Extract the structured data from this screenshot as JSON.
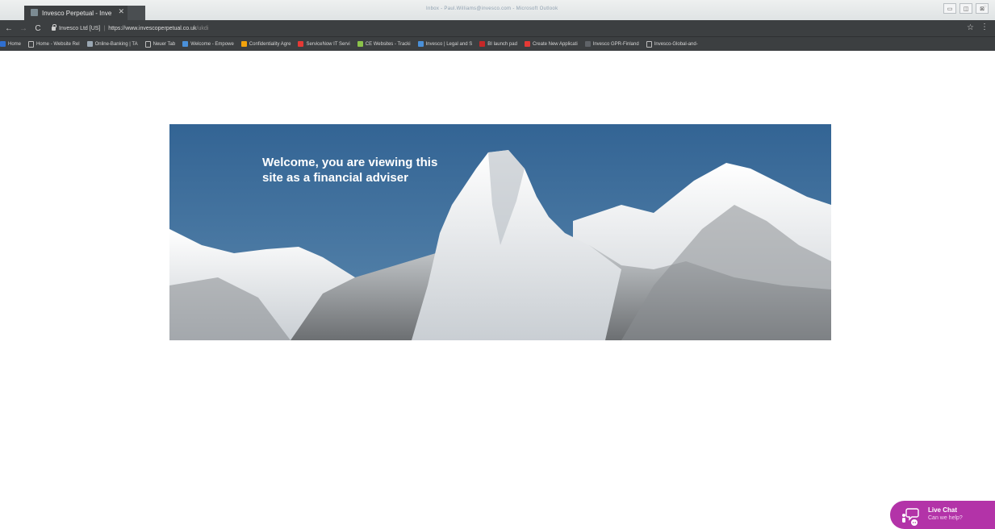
{
  "browser": {
    "tab_title": "Invesco Perpetual - Inve",
    "tab_close": "✕",
    "window_title": "Inbox - Paul.Williams@invesco.com - Microsoft Outlook",
    "controls": [
      "▭",
      "◫",
      "⊠"
    ]
  },
  "address_bar": {
    "site_identity": "Invesco Ltd [US]",
    "url_base": "https://www.invescoperpetual.co.uk",
    "url_path": "/ukdi"
  },
  "bookmarks": [
    {
      "label": "Home",
      "icon": "app-icon",
      "color": "#2f6fd0"
    },
    {
      "label": "Home - Website Rel",
      "icon": "page-icon",
      "color": ""
    },
    {
      "label": "Online-Banking | TA",
      "icon": "mail-icon",
      "color": "#9aa7b3"
    },
    {
      "label": "Neuer Tab",
      "icon": "page-icon",
      "color": ""
    },
    {
      "label": "Welcome - Empowe",
      "icon": "feather-icon",
      "color": "#4a90d9"
    },
    {
      "label": "Confidentiality Agre",
      "icon": "doc-icon",
      "color": "#f2a20c"
    },
    {
      "label": "ServiceNow IT Servi",
      "icon": "servicenow-icon",
      "color": "#e53935"
    },
    {
      "label": "CE Websites - Tracki",
      "icon": "tracker-icon",
      "color": "#8bc34a"
    },
    {
      "label": "Invesco | Legal and S",
      "icon": "feather-icon",
      "color": "#4a90d9"
    },
    {
      "label": "BI launch pad",
      "icon": "bi-icon",
      "color": "#c62828"
    },
    {
      "label": "Create New Applicati",
      "icon": "servicenow-icon",
      "color": "#e53935"
    },
    {
      "label": "Invesco GPR-Finland",
      "icon": "globe-icon",
      "color": "#5f6368"
    },
    {
      "label": "Invesco-Global-and-",
      "icon": "page-icon",
      "color": ""
    }
  ],
  "bookmarks_more": "»",
  "hero": {
    "heading_line1": "Welcome, you are viewing this",
    "heading_line2": "site as a financial adviser"
  },
  "live_chat": {
    "title": "Live Chat",
    "subtitle": "Can we help?",
    "color": "#b333a8"
  }
}
